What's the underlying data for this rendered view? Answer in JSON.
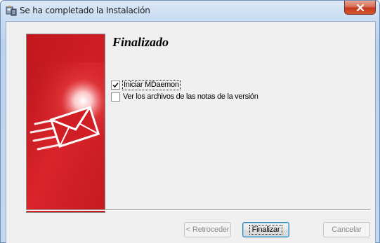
{
  "window": {
    "title": "Se ha completado la Instalación",
    "close_symbol": "x"
  },
  "icons": {
    "app": "installer-icon",
    "close": "close-icon",
    "banner": "mail-envelope-icon",
    "check": "checkmark-icon"
  },
  "main": {
    "heading": "Finalizado",
    "options": [
      {
        "label": "Iniciar MDaemon",
        "checked": true
      },
      {
        "label": "Ver los archivos de las notas de la versión",
        "checked": false
      }
    ]
  },
  "buttons": {
    "back": "< Retroceder",
    "finish": "Finalizar",
    "cancel": "Cancelar"
  },
  "colors": {
    "banner_red": "#d01e24",
    "close_red": "#c3391f"
  }
}
